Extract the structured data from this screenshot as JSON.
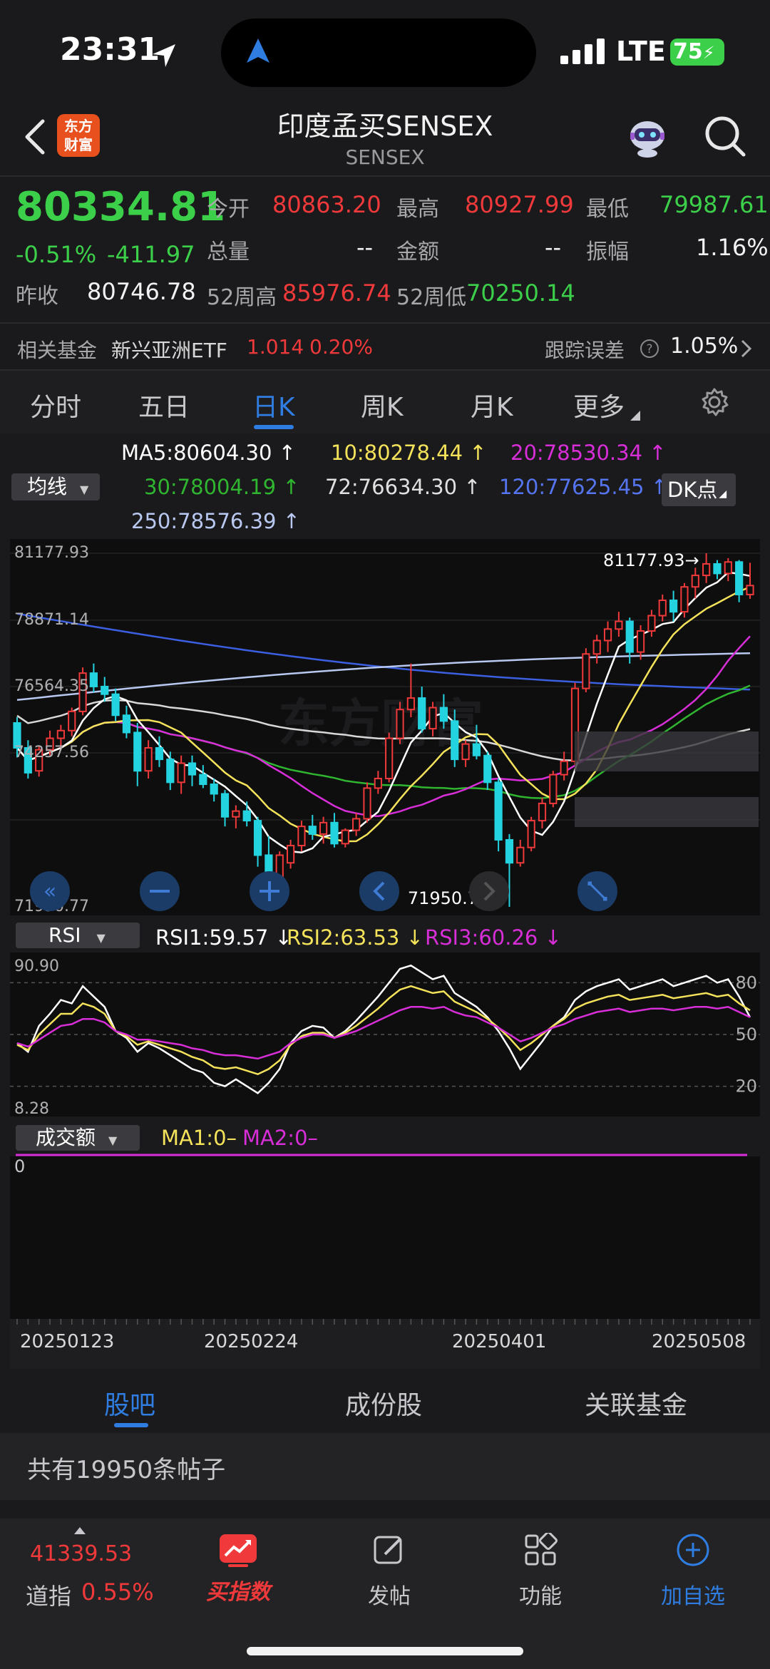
{
  "status": {
    "time": "23:31",
    "network": "LTE",
    "battery": "75"
  },
  "header": {
    "logo_text": "东方财富",
    "title": "印度孟买SENSEX",
    "subtitle": "SENSEX"
  },
  "quote": {
    "price": "80334.81",
    "change_pct": "-0.51%",
    "change_abs": "-411.97",
    "prev_close_label": "昨收",
    "prev_close": "80746.78",
    "open_label": "今开",
    "open": "80863.20",
    "high_label": "最高",
    "high": "80927.99",
    "low_label": "最低",
    "low": "79987.61",
    "volume_label": "总量",
    "volume": "--",
    "amount_label": "金额",
    "amount": "--",
    "amplitude_label": "振幅",
    "amplitude": "1.16%",
    "wk52_high_label": "52周高",
    "wk52_high": "85976.74",
    "wk52_low_label": "52周低",
    "wk52_low": "70250.14"
  },
  "fund": {
    "label": "相关基金",
    "name": "新兴亚洲ETF",
    "price": "1.014",
    "change": "0.20%",
    "tracking_label": "跟踪误差",
    "tracking_value": "1.05%"
  },
  "period_tabs": [
    "分时",
    "五日",
    "日K",
    "周K",
    "月K",
    "更多"
  ],
  "active_period": "日K",
  "ma_legend": {
    "select": "均线",
    "ma5": "MA5:80604.30",
    "ma10": "10:80278.44",
    "ma20": "20:78530.34",
    "ma30": "30:78004.19",
    "ma72": "72:76634.30",
    "ma120": "120:77625.45",
    "ma250": "250:78576.39",
    "dk": "DK点"
  },
  "colors": {
    "up": "#f0393a",
    "down": "#24d3e0",
    "ma5": "#ffffff",
    "ma10": "#f4e35a",
    "ma20": "#d72ed8",
    "ma30": "#2fb52f",
    "ma72": "#d8d8d8",
    "ma120": "#3b5fe0",
    "ma250": "#b8c8f0",
    "accent": "#2f7de1"
  },
  "chart_data": [
    {
      "type": "candlestick",
      "title": "",
      "y_ticks": [
        "81177.93",
        "78871.14",
        "76564.35",
        "74257.56",
        "71950.77"
      ],
      "ylim": [
        71950.77,
        81177.93
      ],
      "annotations": {
        "max": "81177.93",
        "min": "71950.77"
      },
      "x_ticks": [
        "20250123",
        "20250224",
        "20250401",
        "20250508"
      ],
      "ohlc": [
        [
          76750,
          76900,
          75850,
          76100
        ],
        [
          76100,
          76300,
          75300,
          75450
        ],
        [
          75500,
          76150,
          75350,
          76050
        ],
        [
          76050,
          76550,
          75900,
          76350
        ],
        [
          76350,
          76700,
          76100,
          76550
        ],
        [
          76550,
          77150,
          76400,
          77050
        ],
        [
          77050,
          78200,
          76950,
          78050
        ],
        [
          78050,
          78300,
          77550,
          77700
        ],
        [
          77700,
          77950,
          77300,
          77500
        ],
        [
          77500,
          77650,
          76800,
          76950
        ],
        [
          76950,
          77200,
          76350,
          76500
        ],
        [
          76500,
          76750,
          75100,
          75500
        ],
        [
          75500,
          76300,
          75300,
          76100
        ],
        [
          76100,
          76400,
          75600,
          75800
        ],
        [
          75800,
          76000,
          75000,
          75200
        ],
        [
          75200,
          75900,
          74900,
          75700
        ],
        [
          75700,
          75900,
          75100,
          75400
        ],
        [
          75400,
          75650,
          75050,
          75150
        ],
        [
          75150,
          75300,
          74700,
          74900
        ],
        [
          74900,
          75000,
          74050,
          74300
        ],
        [
          74300,
          74600,
          74000,
          74450
        ],
        [
          74450,
          74700,
          74050,
          74200
        ],
        [
          74200,
          74300,
          73000,
          73300
        ],
        [
          73300,
          73800,
          72300,
          72650
        ],
        [
          72650,
          73400,
          72500,
          73300
        ],
        [
          73100,
          73700,
          72950,
          73550
        ],
        [
          73550,
          74200,
          73400,
          74050
        ],
        [
          74050,
          74350,
          73700,
          73850
        ],
        [
          73850,
          74300,
          73600,
          74150
        ],
        [
          74150,
          74400,
          73500,
          73600
        ],
        [
          73600,
          74000,
          73500,
          73950
        ],
        [
          73950,
          74400,
          73800,
          74250
        ],
        [
          74250,
          75200,
          74150,
          75050
        ],
        [
          75050,
          75500,
          74900,
          75300
        ],
        [
          75300,
          76500,
          75200,
          76350
        ],
        [
          76350,
          77300,
          76200,
          77100
        ],
        [
          77100,
          78300,
          76900,
          77400
        ],
        [
          77400,
          77700,
          76500,
          76600
        ],
        [
          76600,
          77300,
          76400,
          77150
        ],
        [
          77150,
          77500,
          76600,
          76800
        ],
        [
          76800,
          77100,
          75600,
          75800
        ],
        [
          75800,
          76300,
          75600,
          76200
        ],
        [
          76200,
          76700,
          75800,
          75900
        ],
        [
          75900,
          76000,
          75000,
          75200
        ],
        [
          75200,
          75300,
          73400,
          73700
        ],
        [
          73700,
          73850,
          71950,
          73100
        ],
        [
          73100,
          73700,
          73000,
          73500
        ],
        [
          73500,
          74300,
          73400,
          74200
        ],
        [
          74200,
          74800,
          74000,
          74650
        ],
        [
          74650,
          75500,
          74550,
          75400
        ],
        [
          75400,
          76000,
          75250,
          75750
        ],
        [
          75750,
          77800,
          75650,
          77650
        ],
        [
          77650,
          78700,
          77550,
          78550
        ],
        [
          78550,
          79050,
          78300,
          78900
        ],
        [
          78900,
          79400,
          78600,
          79200
        ],
        [
          79200,
          79650,
          79000,
          79400
        ],
        [
          79400,
          79500,
          78300,
          78600
        ],
        [
          78600,
          79300,
          78400,
          79150
        ],
        [
          79150,
          79700,
          79000,
          79550
        ],
        [
          79550,
          80100,
          79400,
          79950
        ],
        [
          79950,
          80200,
          79400,
          79650
        ],
        [
          79650,
          80400,
          79500,
          80300
        ],
        [
          80300,
          80800,
          80000,
          80600
        ],
        [
          80600,
          81177.93,
          80400,
          80900
        ],
        [
          80900,
          81000,
          80500,
          80650
        ],
        [
          80650,
          81050,
          80450,
          80950
        ],
        [
          80950,
          81000,
          79900,
          80100
        ],
        [
          80100,
          80930,
          79990,
          80335
        ]
      ]
    },
    {
      "type": "line",
      "title": "RSI",
      "select": "RSI",
      "legend": {
        "rsi1": "RSI1:59.57",
        "rsi2": "RSI2:63.53",
        "rsi3": "RSI3:60.26"
      },
      "y_ticks_left": [
        "90.90",
        "8.28"
      ],
      "y_ticks_right": [
        "80",
        "50",
        "20"
      ],
      "ylim": [
        8.28,
        90.9
      ],
      "series": [
        {
          "name": "RSI1",
          "values": [
            45,
            40,
            55,
            62,
            70,
            68,
            78,
            72,
            66,
            52,
            48,
            40,
            45,
            42,
            38,
            34,
            30,
            28,
            22,
            20,
            24,
            20,
            16,
            22,
            30,
            45,
            52,
            55,
            54,
            48,
            52,
            58,
            65,
            72,
            80,
            88,
            90,
            86,
            82,
            84,
            74,
            70,
            66,
            60,
            52,
            42,
            30,
            38,
            46,
            55,
            60,
            70,
            75,
            78,
            80,
            82,
            76,
            78,
            80,
            82,
            78,
            80,
            82,
            84,
            80,
            82,
            72,
            60
          ]
        },
        {
          "name": "RSI2",
          "values": [
            44,
            41,
            50,
            56,
            62,
            62,
            68,
            66,
            62,
            52,
            49,
            44,
            46,
            44,
            42,
            40,
            37,
            35,
            31,
            30,
            31,
            29,
            27,
            30,
            35,
            44,
            49,
            51,
            51,
            48,
            51,
            55,
            60,
            65,
            71,
            76,
            78,
            76,
            74,
            75,
            69,
            66,
            63,
            59,
            54,
            48,
            41,
            45,
            50,
            55,
            59,
            65,
            68,
            70,
            72,
            73,
            70,
            71,
            72,
            73,
            71,
            72,
            73,
            74,
            72,
            73,
            68,
            64
          ]
        },
        {
          "name": "RSI3",
          "values": [
            45,
            43,
            47,
            51,
            55,
            56,
            59,
            59,
            57,
            52,
            50,
            47,
            47,
            46,
            45,
            44,
            42,
            41,
            39,
            38,
            38,
            37,
            36,
            38,
            40,
            45,
            48,
            50,
            50,
            48,
            50,
            52,
            55,
            58,
            61,
            64,
            66,
            66,
            65,
            66,
            63,
            61,
            60,
            57,
            54,
            50,
            46,
            48,
            51,
            54,
            56,
            59,
            61,
            63,
            64,
            65,
            63,
            64,
            65,
            65,
            64,
            65,
            66,
            66,
            65,
            66,
            63,
            60
          ]
        }
      ]
    },
    {
      "type": "line",
      "title": "成交额",
      "select": "成交额",
      "legend": {
        "ma1": "MA1:0",
        "ma2": "MA2:0"
      },
      "y_ticks": [
        "0"
      ],
      "series": [
        {
          "name": "MA2",
          "values": [
            0,
            0
          ]
        }
      ]
    }
  ],
  "chart_controls": [
    "move-left",
    "zoom-out",
    "zoom-in",
    "step-left",
    "step-right",
    "fullscreen"
  ],
  "content_tabs": [
    "股吧",
    "成份股",
    "关联基金"
  ],
  "active_content_tab": "股吧",
  "posts_text": "共有19950条帖子",
  "bottom_nav": {
    "dow_value": "41339.53",
    "dow_label": "道指",
    "dow_change": "0.55%",
    "buy_index": "买指数",
    "post": "发帖",
    "functions": "功能",
    "add_watch": "加自选"
  }
}
